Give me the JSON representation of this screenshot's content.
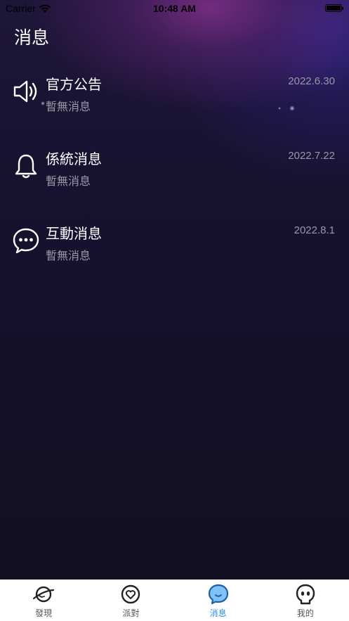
{
  "status_bar": {
    "carrier": "Carrier",
    "time": "10:48 AM"
  },
  "page": {
    "title": "消息"
  },
  "messages": [
    {
      "icon": "speaker-icon",
      "title": "官方公告",
      "subtitle": "暫無消息",
      "date": "2022.6.30"
    },
    {
      "icon": "bell-icon",
      "title": "係統消息",
      "subtitle": "暫無消息",
      "date": "2022.7.22"
    },
    {
      "icon": "chat-bubble-icon",
      "title": "互動消息",
      "subtitle": "暫無消息",
      "date": "2022.8.1"
    }
  ],
  "tab_bar": {
    "active_color": "#2a8cf0",
    "tabs": [
      {
        "label": "發現",
        "icon": "planet-icon",
        "active": false
      },
      {
        "label": "派對",
        "icon": "heart-circle-icon",
        "active": false
      },
      {
        "label": "消息",
        "icon": "message-bubble-icon",
        "active": true
      },
      {
        "label": "我的",
        "icon": "ghost-face-icon",
        "active": false
      }
    ]
  }
}
